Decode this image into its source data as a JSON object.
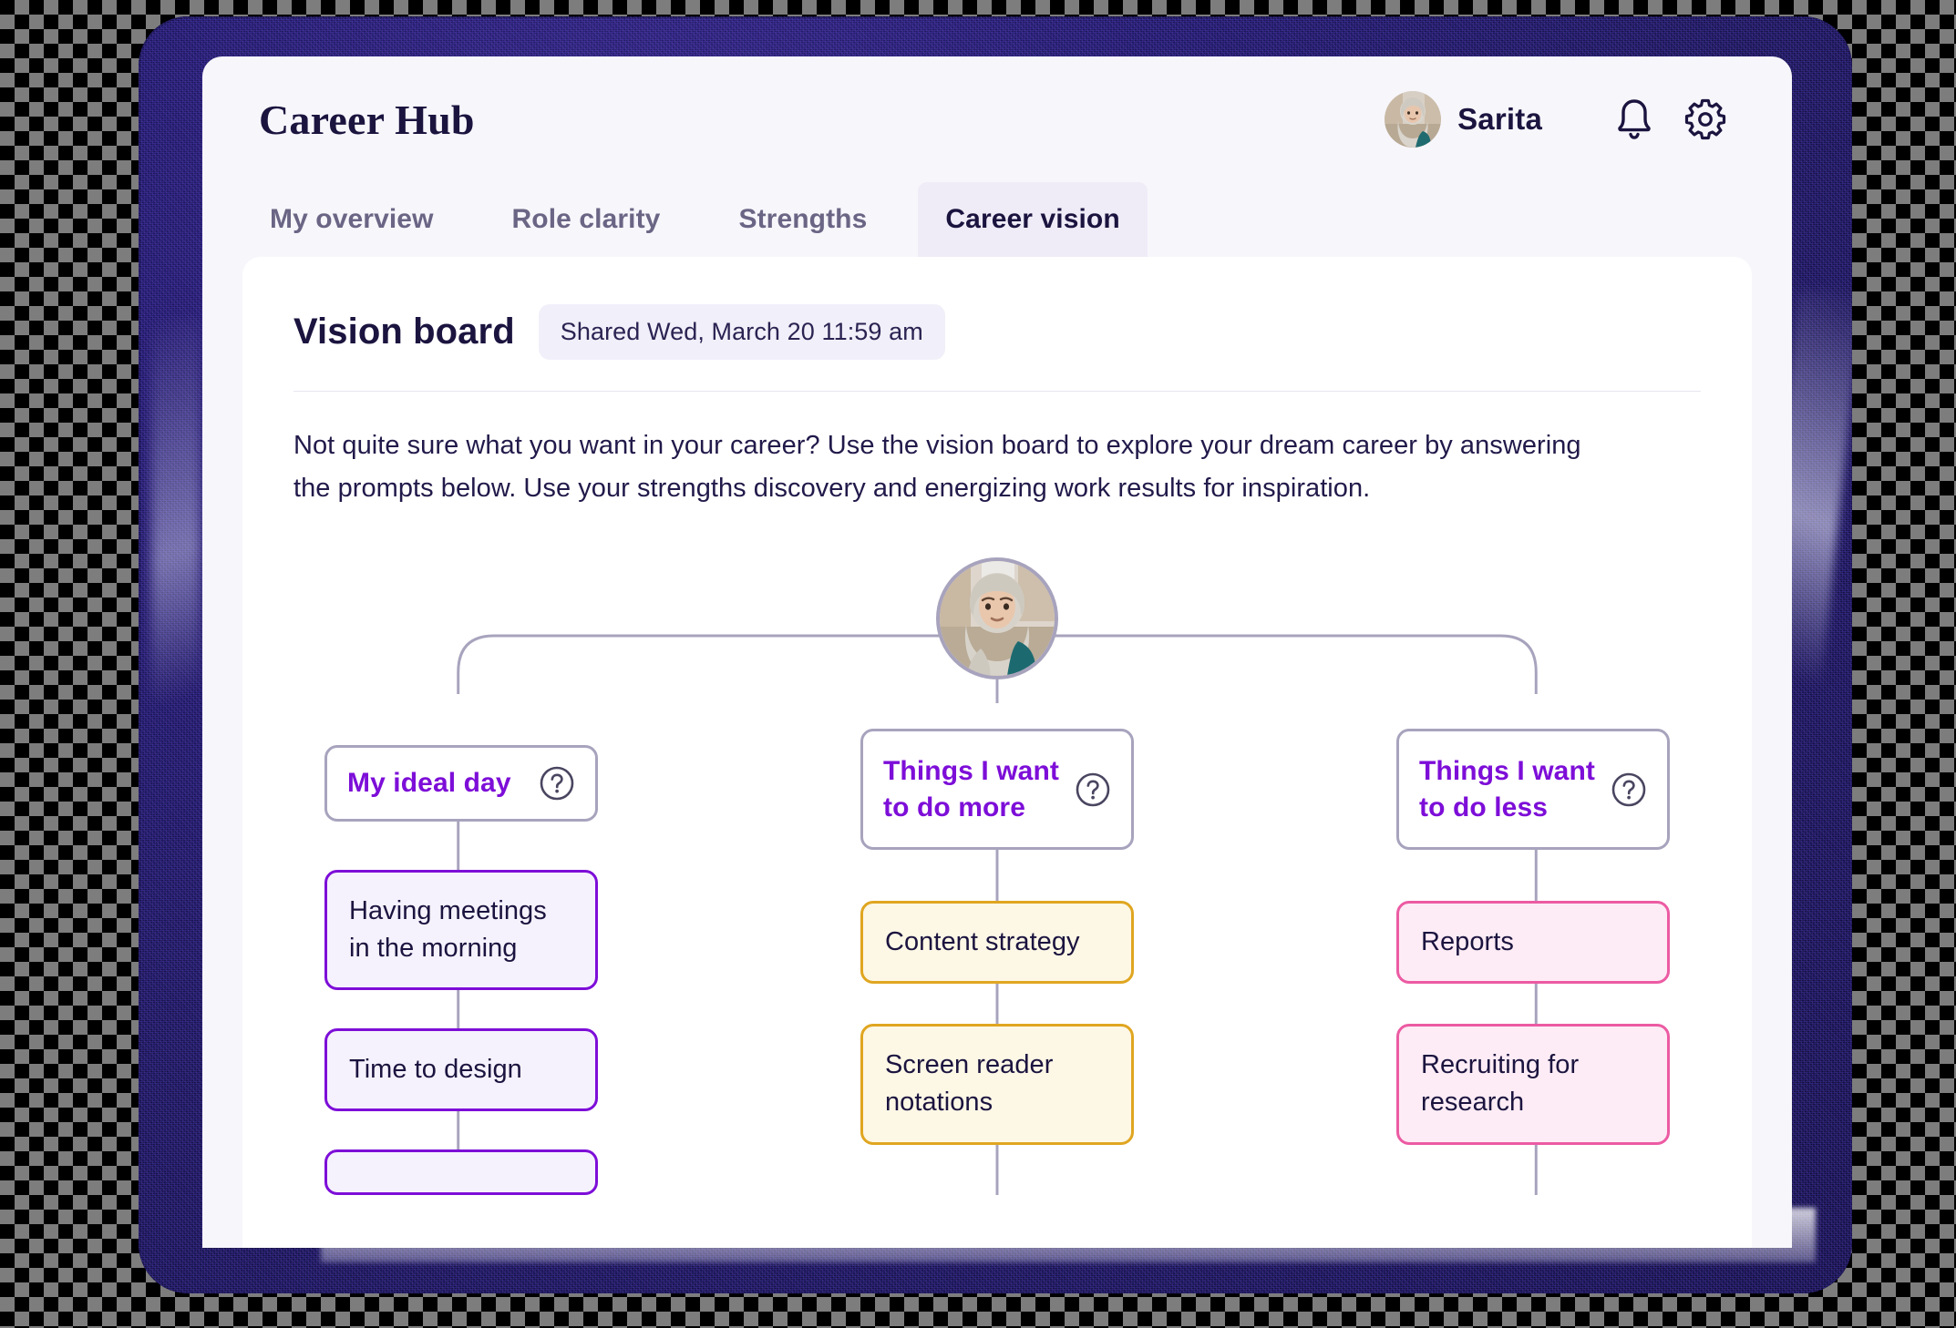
{
  "app": {
    "title": "Career Hub",
    "user_name": "Sarita",
    "icons": {
      "notifications": "bell-icon",
      "settings": "gear-icon",
      "avatar": "user-avatar"
    }
  },
  "tabs": [
    {
      "label": "My overview",
      "active": false
    },
    {
      "label": "Role clarity",
      "active": false
    },
    {
      "label": "Strengths",
      "active": false
    },
    {
      "label": "Career vision",
      "active": true
    }
  ],
  "board": {
    "title": "Vision board",
    "shared_badge": "Shared Wed, March 20 11:59 am",
    "description": "Not quite sure what you want in your career? Use the vision board to explore your dream career by answering the prompts below. Use your strengths discovery and energizing work results for inspiration."
  },
  "mindmap": {
    "center_avatar": "user-avatar-large",
    "help_icon": "question-mark-circle-icon",
    "columns": [
      {
        "prompt": "My ideal day",
        "accent": "purple",
        "items": [
          "Having meetings in the morning",
          "Time to design",
          ""
        ]
      },
      {
        "prompt_line1": "Things I want",
        "prompt_line2": "to do more",
        "accent": "amber",
        "items": [
          "Content strategy",
          "Screen reader notations"
        ]
      },
      {
        "prompt_line1": "Things I want",
        "prompt_line2": "to do less",
        "accent": "pink",
        "items": [
          "Reports",
          "Recruiting for research"
        ]
      }
    ]
  },
  "colors": {
    "brand_purple": "#7d0ed8",
    "navy_text": "#1b143f",
    "amber": "#e0a621",
    "pink": "#ec5ba3",
    "connector_gray": "#a8a3bd",
    "screen_bg": "#f7f6fb",
    "device_frame": "#1a1350"
  }
}
